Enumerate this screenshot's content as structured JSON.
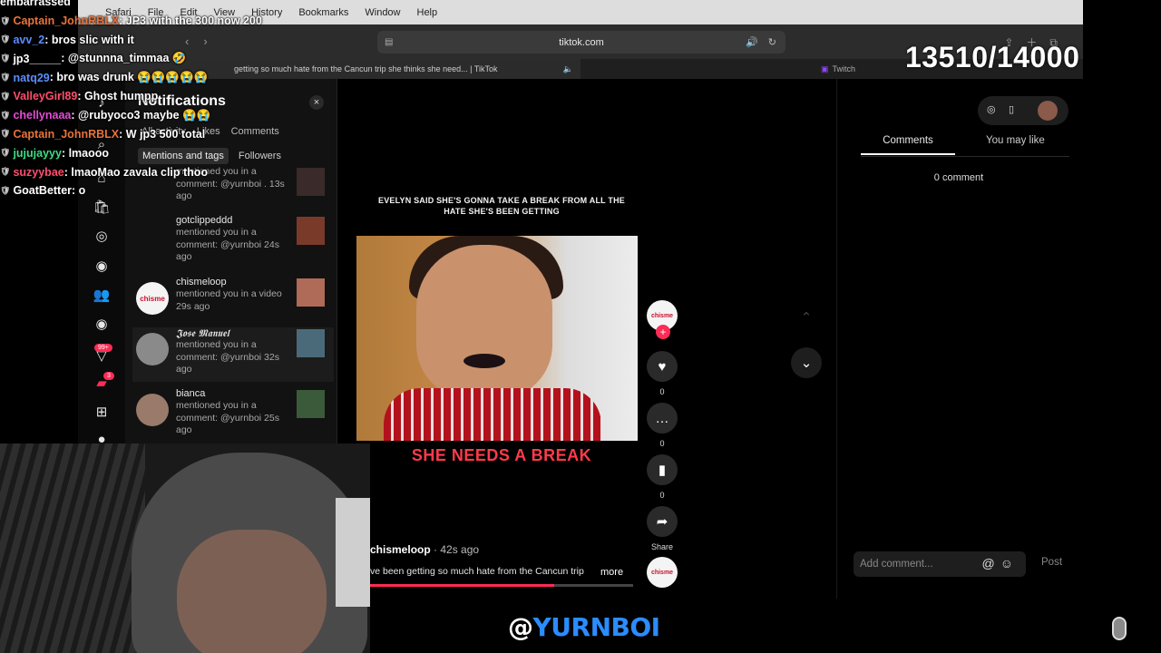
{
  "menubar": {
    "items": [
      "Safari",
      "File",
      "Edit",
      "View",
      "History",
      "Bookmarks",
      "Window",
      "Help"
    ]
  },
  "toolbar": {
    "url": "tiktok.com"
  },
  "tabs": {
    "active_title": "getting so much hate from the Cancun trip she thinks she need... | TikTok",
    "second_title": "Twitch"
  },
  "notifications": {
    "title": "Notifications",
    "close": "×",
    "tabs": [
      "All activity",
      "Likes",
      "Comments"
    ],
    "chips": [
      "Mentions and tags",
      "Followers"
    ],
    "items": [
      {
        "name": "",
        "text": "mentioned you in a comment: @yurnboi . 13s ago"
      },
      {
        "name": "gotclippeddd",
        "text": "mentioned you in a comment: @yurnboi 24s ago"
      },
      {
        "name": "chismeloop",
        "text": "mentioned you in a video 29s ago"
      },
      {
        "name": "𝕵𝖔𝖘𝖊 𝕸𝖆𝖓𝖚𝖊𝖑",
        "text": "mentioned you in a comment: @yurnboi 32s ago"
      },
      {
        "name": "bianca",
        "text": "mentioned you in a comment: @yurnboi 25s ago"
      }
    ]
  },
  "leftnav": {
    "badge_1": "99+",
    "badge_2": "3"
  },
  "video": {
    "caption": "EVELYN SAID SHE'S GONNA TAKE A BREAK FROM ALL THE HATE SHE'S BEEN GETTING",
    "title": "SHE NEEDS A BREAK",
    "author": "chismeloop",
    "ago": " · 42s ago",
    "desc": "ve been getting so much hate from the Cancun trip",
    "more": "more",
    "progress": 0.7
  },
  "actions": {
    "like_count": "0",
    "comment_count": "0",
    "save_count": "0",
    "share_label": "Share"
  },
  "right_panel": {
    "tab_comments": "Comments",
    "tab_you_may_like": "You may like",
    "comment_count": "0 comment",
    "input_placeholder": "Add comment...",
    "post": "Post"
  },
  "chat": [
    {
      "user": "embarrassed",
      "color": "#ffffff",
      "msg": ""
    },
    {
      "user": "Captain_JohnRBLX",
      "color": "#e8743b",
      "msg": ": JP3 with the 300 now 200"
    },
    {
      "user": "avv_2",
      "color": "#5b8cff",
      "msg": ": bros slic with it"
    },
    {
      "user": "jp3_____",
      "color": "#ffffff",
      "msg": ": @stunnna_timmaa 🤣"
    },
    {
      "user": "natq29",
      "color": "#5b8cff",
      "msg": ": bro was drunk 😭😭😭😭😭"
    },
    {
      "user": "ValleyGirl89",
      "color": "#ff4d6d",
      "msg": ": Ghost humpp"
    },
    {
      "user": "chellynaaa",
      "color": "#e64bd8",
      "msg": ": @rubyoco3 maybe 😭😭"
    },
    {
      "user": "Captain_JohnRBLX",
      "color": "#e8743b",
      "msg": ": W jp3 500 total"
    },
    {
      "user": "jujujayyy",
      "color": "#3ddc84",
      "msg": ": lmaooo"
    },
    {
      "user": "suzyybae",
      "color": "#ff4d6d",
      "msg": ": lmaoMao zavala clip thoo"
    },
    {
      "user": "GoatBetter",
      "color": "#ffffff",
      "msg": ": o"
    }
  ],
  "overlay": {
    "counter": "13510/14000",
    "handle_at": "@",
    "handle_name": "YURNBOI"
  }
}
